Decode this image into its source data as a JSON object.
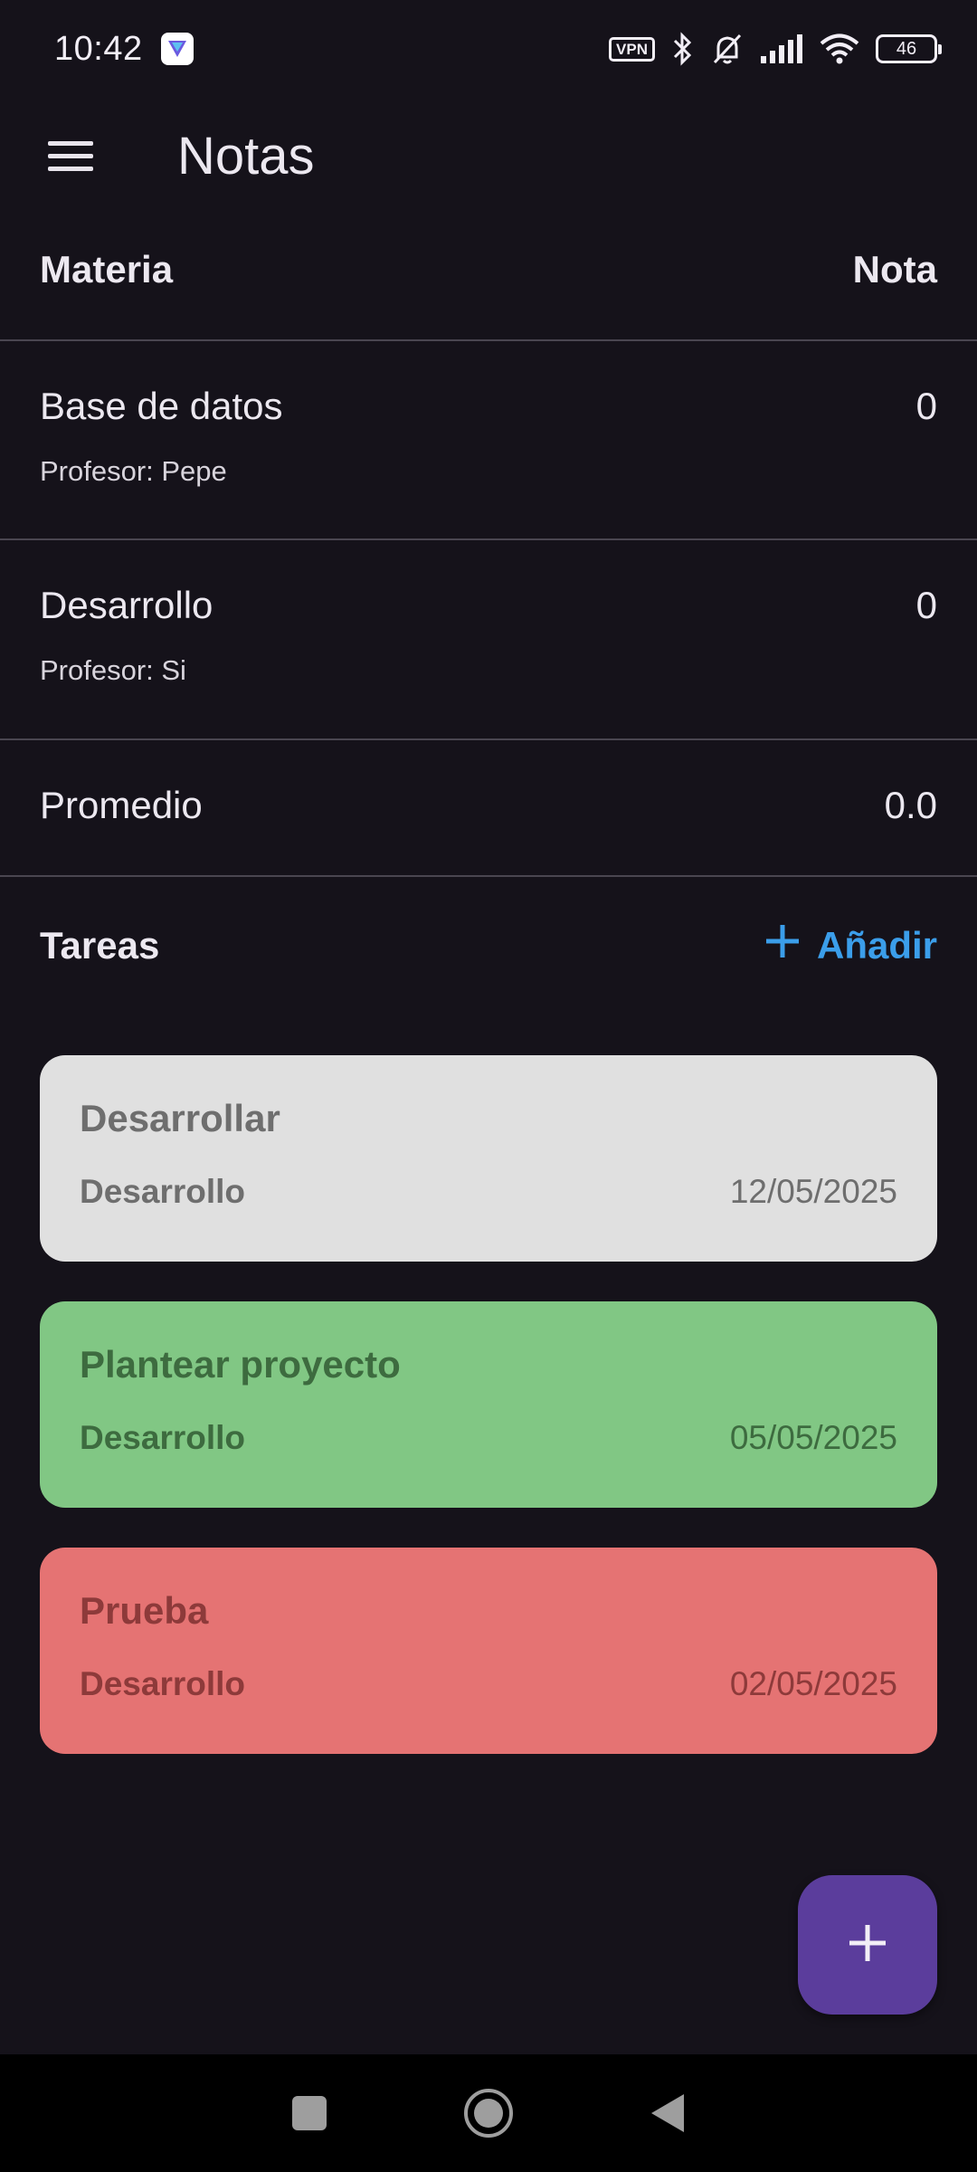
{
  "status_bar": {
    "time": "10:42",
    "vpn_label": "VPN",
    "battery_level": "46",
    "icons": [
      "app-badge-icon",
      "vpn-icon",
      "bluetooth-icon",
      "bell-off-icon",
      "signal-icon",
      "wifi-icon",
      "battery-icon"
    ]
  },
  "app_bar": {
    "title": "Notas",
    "menu_icon": "hamburger-menu-icon"
  },
  "table": {
    "header_subject": "Materia",
    "header_grade": "Nota",
    "subjects": [
      {
        "name": "Base de datos",
        "teacher": "Profesor: Pepe",
        "grade": "0"
      },
      {
        "name": "Desarrollo",
        "teacher": "Profesor: Si",
        "grade": "0"
      }
    ],
    "average_label": "Promedio",
    "average_value": "0.0"
  },
  "tasks_section": {
    "label": "Tareas",
    "add_label": "Añadir",
    "add_icon": "plus-icon",
    "accent_color": "#3b9eea"
  },
  "tasks": [
    {
      "title": "Desarrollar",
      "subject": "Desarrollo",
      "date": "12/05/2025",
      "bg": "#e0e0e0",
      "fg": "#6e6e6e"
    },
    {
      "title": "Plantear proyecto",
      "subject": "Desarrollo",
      "date": "05/05/2025",
      "bg": "#81c784",
      "fg": "#3d6b3f"
    },
    {
      "title": "Prueba",
      "subject": "Desarrollo",
      "date": "02/05/2025",
      "bg": "#e57373",
      "fg": "#8d3a3a"
    }
  ],
  "fab": {
    "icon": "plus-icon",
    "color": "#5b3d9c"
  },
  "nav_bar": {
    "icons": [
      "recents-square-icon",
      "home-circle-icon",
      "back-triangle-icon"
    ]
  }
}
